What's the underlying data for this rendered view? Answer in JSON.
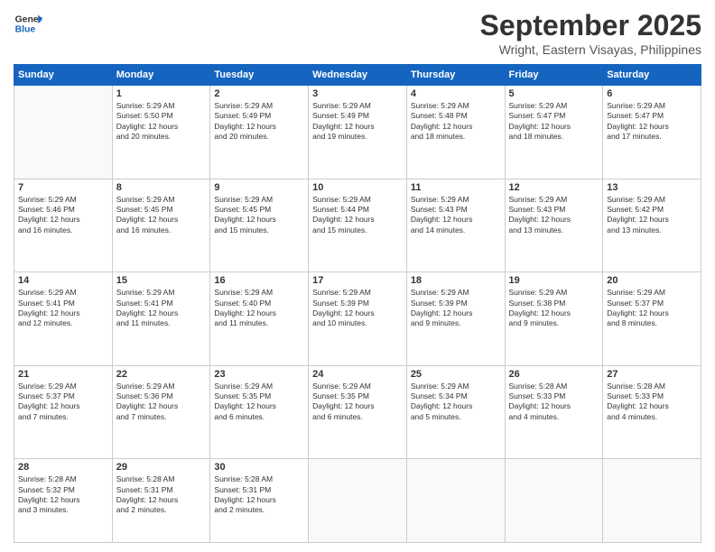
{
  "logo": {
    "line1": "General",
    "line2": "Blue"
  },
  "title": "September 2025",
  "location": "Wright, Eastern Visayas, Philippines",
  "headers": [
    "Sunday",
    "Monday",
    "Tuesday",
    "Wednesday",
    "Thursday",
    "Friday",
    "Saturday"
  ],
  "rows": [
    [
      {
        "day": "",
        "text": ""
      },
      {
        "day": "1",
        "text": "Sunrise: 5:29 AM\nSunset: 5:50 PM\nDaylight: 12 hours\nand 20 minutes."
      },
      {
        "day": "2",
        "text": "Sunrise: 5:29 AM\nSunset: 5:49 PM\nDaylight: 12 hours\nand 20 minutes."
      },
      {
        "day": "3",
        "text": "Sunrise: 5:29 AM\nSunset: 5:49 PM\nDaylight: 12 hours\nand 19 minutes."
      },
      {
        "day": "4",
        "text": "Sunrise: 5:29 AM\nSunset: 5:48 PM\nDaylight: 12 hours\nand 18 minutes."
      },
      {
        "day": "5",
        "text": "Sunrise: 5:29 AM\nSunset: 5:47 PM\nDaylight: 12 hours\nand 18 minutes."
      },
      {
        "day": "6",
        "text": "Sunrise: 5:29 AM\nSunset: 5:47 PM\nDaylight: 12 hours\nand 17 minutes."
      }
    ],
    [
      {
        "day": "7",
        "text": "Sunrise: 5:29 AM\nSunset: 5:46 PM\nDaylight: 12 hours\nand 16 minutes."
      },
      {
        "day": "8",
        "text": "Sunrise: 5:29 AM\nSunset: 5:45 PM\nDaylight: 12 hours\nand 16 minutes."
      },
      {
        "day": "9",
        "text": "Sunrise: 5:29 AM\nSunset: 5:45 PM\nDaylight: 12 hours\nand 15 minutes."
      },
      {
        "day": "10",
        "text": "Sunrise: 5:29 AM\nSunset: 5:44 PM\nDaylight: 12 hours\nand 15 minutes."
      },
      {
        "day": "11",
        "text": "Sunrise: 5:29 AM\nSunset: 5:43 PM\nDaylight: 12 hours\nand 14 minutes."
      },
      {
        "day": "12",
        "text": "Sunrise: 5:29 AM\nSunset: 5:43 PM\nDaylight: 12 hours\nand 13 minutes."
      },
      {
        "day": "13",
        "text": "Sunrise: 5:29 AM\nSunset: 5:42 PM\nDaylight: 12 hours\nand 13 minutes."
      }
    ],
    [
      {
        "day": "14",
        "text": "Sunrise: 5:29 AM\nSunset: 5:41 PM\nDaylight: 12 hours\nand 12 minutes."
      },
      {
        "day": "15",
        "text": "Sunrise: 5:29 AM\nSunset: 5:41 PM\nDaylight: 12 hours\nand 11 minutes."
      },
      {
        "day": "16",
        "text": "Sunrise: 5:29 AM\nSunset: 5:40 PM\nDaylight: 12 hours\nand 11 minutes."
      },
      {
        "day": "17",
        "text": "Sunrise: 5:29 AM\nSunset: 5:39 PM\nDaylight: 12 hours\nand 10 minutes."
      },
      {
        "day": "18",
        "text": "Sunrise: 5:29 AM\nSunset: 5:39 PM\nDaylight: 12 hours\nand 9 minutes."
      },
      {
        "day": "19",
        "text": "Sunrise: 5:29 AM\nSunset: 5:38 PM\nDaylight: 12 hours\nand 9 minutes."
      },
      {
        "day": "20",
        "text": "Sunrise: 5:29 AM\nSunset: 5:37 PM\nDaylight: 12 hours\nand 8 minutes."
      }
    ],
    [
      {
        "day": "21",
        "text": "Sunrise: 5:29 AM\nSunset: 5:37 PM\nDaylight: 12 hours\nand 7 minutes."
      },
      {
        "day": "22",
        "text": "Sunrise: 5:29 AM\nSunset: 5:36 PM\nDaylight: 12 hours\nand 7 minutes."
      },
      {
        "day": "23",
        "text": "Sunrise: 5:29 AM\nSunset: 5:35 PM\nDaylight: 12 hours\nand 6 minutes."
      },
      {
        "day": "24",
        "text": "Sunrise: 5:29 AM\nSunset: 5:35 PM\nDaylight: 12 hours\nand 6 minutes."
      },
      {
        "day": "25",
        "text": "Sunrise: 5:29 AM\nSunset: 5:34 PM\nDaylight: 12 hours\nand 5 minutes."
      },
      {
        "day": "26",
        "text": "Sunrise: 5:28 AM\nSunset: 5:33 PM\nDaylight: 12 hours\nand 4 minutes."
      },
      {
        "day": "27",
        "text": "Sunrise: 5:28 AM\nSunset: 5:33 PM\nDaylight: 12 hours\nand 4 minutes."
      }
    ],
    [
      {
        "day": "28",
        "text": "Sunrise: 5:28 AM\nSunset: 5:32 PM\nDaylight: 12 hours\nand 3 minutes."
      },
      {
        "day": "29",
        "text": "Sunrise: 5:28 AM\nSunset: 5:31 PM\nDaylight: 12 hours\nand 2 minutes."
      },
      {
        "day": "30",
        "text": "Sunrise: 5:28 AM\nSunset: 5:31 PM\nDaylight: 12 hours\nand 2 minutes."
      },
      {
        "day": "",
        "text": ""
      },
      {
        "day": "",
        "text": ""
      },
      {
        "day": "",
        "text": ""
      },
      {
        "day": "",
        "text": ""
      }
    ]
  ]
}
